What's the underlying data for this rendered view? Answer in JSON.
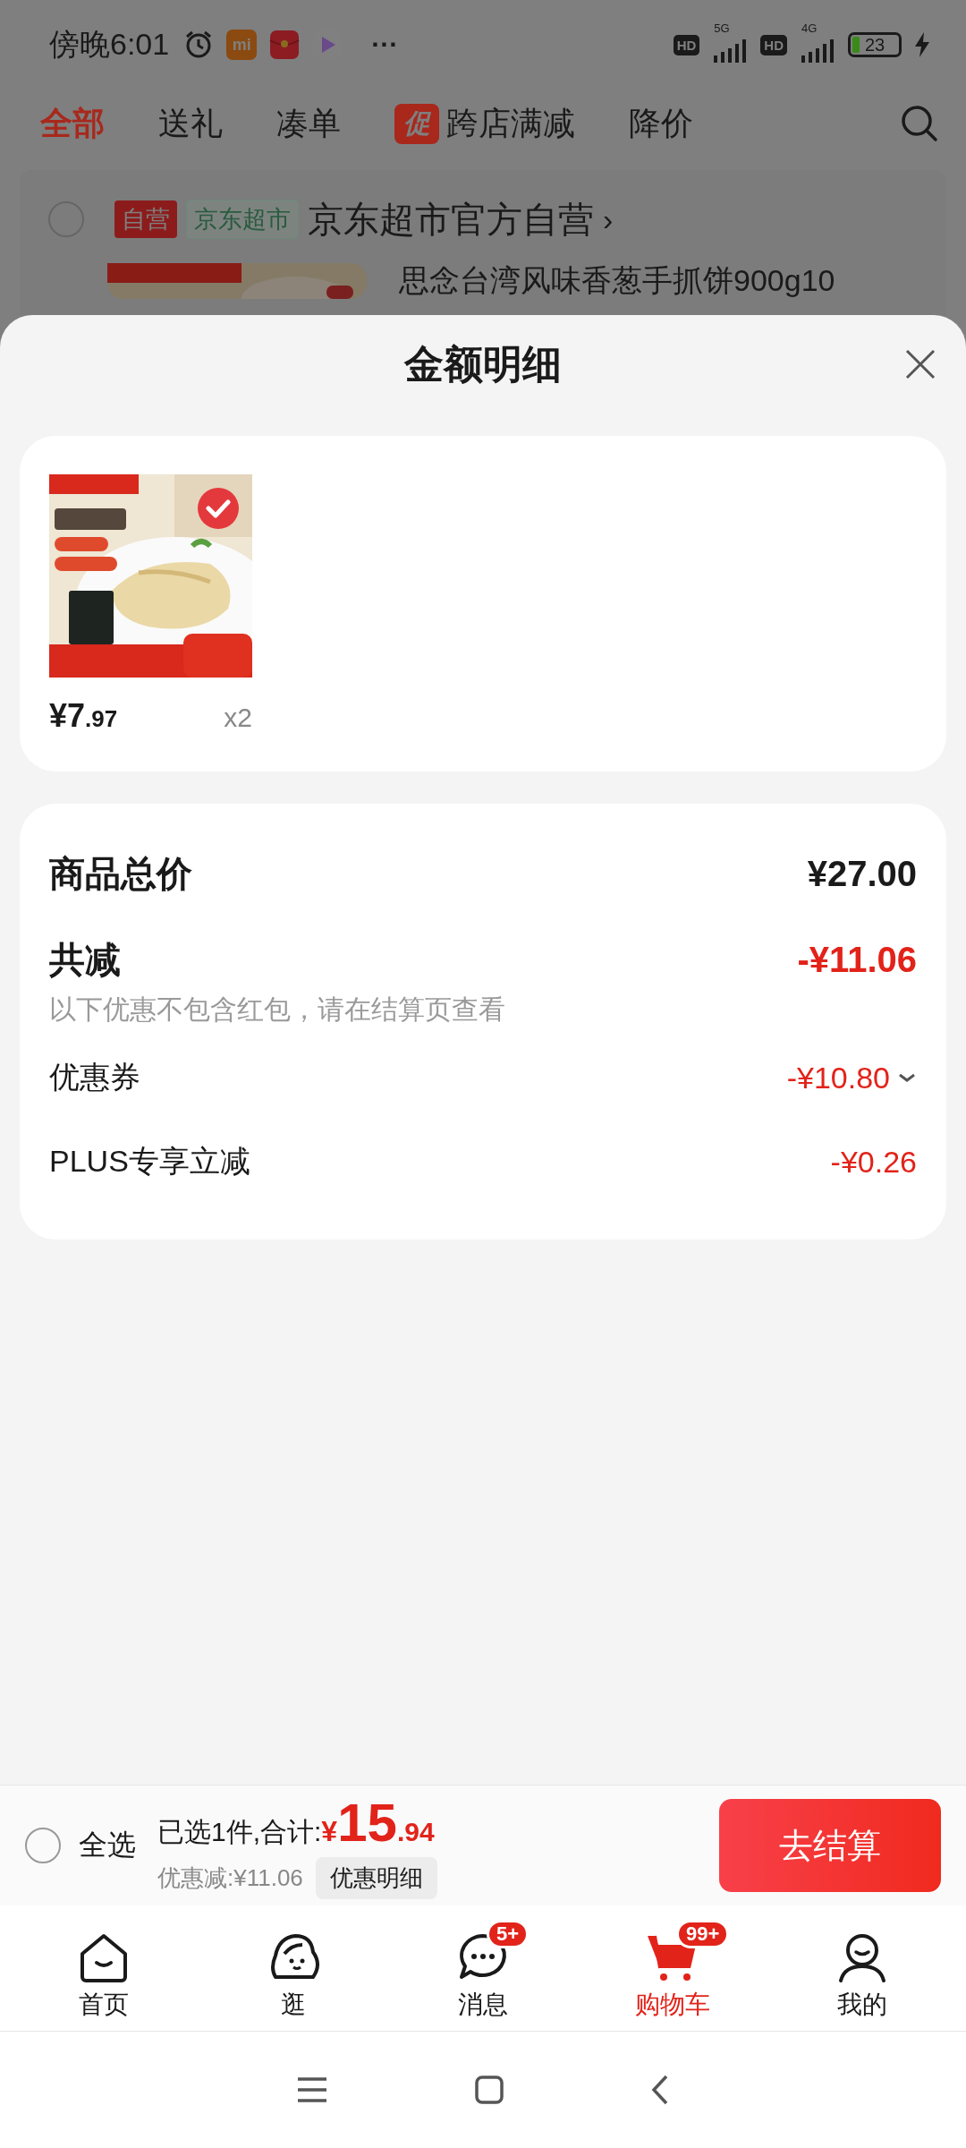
{
  "status_bar": {
    "time": "傍晚6:01",
    "notification_icons": [
      {
        "kind": "mi",
        "label": "mi"
      },
      {
        "kind": "envelope"
      },
      {
        "kind": "play"
      }
    ],
    "more": "···",
    "sim_slots": [
      {
        "hd": "HD",
        "network": "5G"
      },
      {
        "hd": "HD",
        "network": "4G"
      }
    ],
    "battery": "23",
    "charging": true
  },
  "category_tabs": [
    {
      "label": "全部",
      "selected": true
    },
    {
      "label": "送礼",
      "selected": false
    },
    {
      "label": "凑单",
      "selected": false
    },
    {
      "label": "跨店满减",
      "selected": false,
      "badge": "促"
    },
    {
      "label": "降价",
      "selected": false
    }
  ],
  "store": {
    "checked": false,
    "tags": [
      {
        "label": "自营",
        "kind": "solid"
      },
      {
        "label": "京东超市",
        "kind": "outline"
      }
    ],
    "name": "京东超市官方自营",
    "chevron": "›"
  },
  "background_product": {
    "title": "思念台湾风味香葱手抓饼900g10"
  },
  "sheet": {
    "title": "金额明细",
    "items": [
      {
        "selected": true,
        "price_main": "¥7",
        "price_decimal": ".97",
        "quantity": "x2"
      }
    ],
    "summary": [
      {
        "kind": "total",
        "label": "商品总价",
        "value": "¥27.00"
      },
      {
        "kind": "discount_total",
        "label": "共减",
        "value": "-¥11.06"
      },
      {
        "kind": "note",
        "label": "以下优惠不包含红包，请在结算页查看"
      },
      {
        "kind": "discount",
        "label": "优惠券",
        "value": "-¥10.80",
        "expandable": true
      },
      {
        "kind": "discount",
        "label": "PLUS专享立减",
        "value": "-¥0.26",
        "expandable": false
      }
    ]
  },
  "checkout_bar": {
    "select_all": {
      "label": "全选",
      "checked": false
    },
    "selected_text": "已选1件,合计:",
    "currency": "¥",
    "total_main": "15",
    "total_decimal": ".94",
    "discount_text": "优惠减:¥11.06",
    "detail_button": "优惠明细",
    "checkout_button": "去结算"
  },
  "bottom_nav": [
    {
      "kind": "home",
      "label": "首页",
      "selected": false
    },
    {
      "kind": "browse",
      "label": "逛",
      "selected": false
    },
    {
      "kind": "message",
      "label": "消息",
      "selected": false,
      "badge": "5+"
    },
    {
      "kind": "cart",
      "label": "购物车",
      "selected": true,
      "badge": "99+"
    },
    {
      "kind": "me",
      "label": "我的",
      "selected": false
    }
  ]
}
